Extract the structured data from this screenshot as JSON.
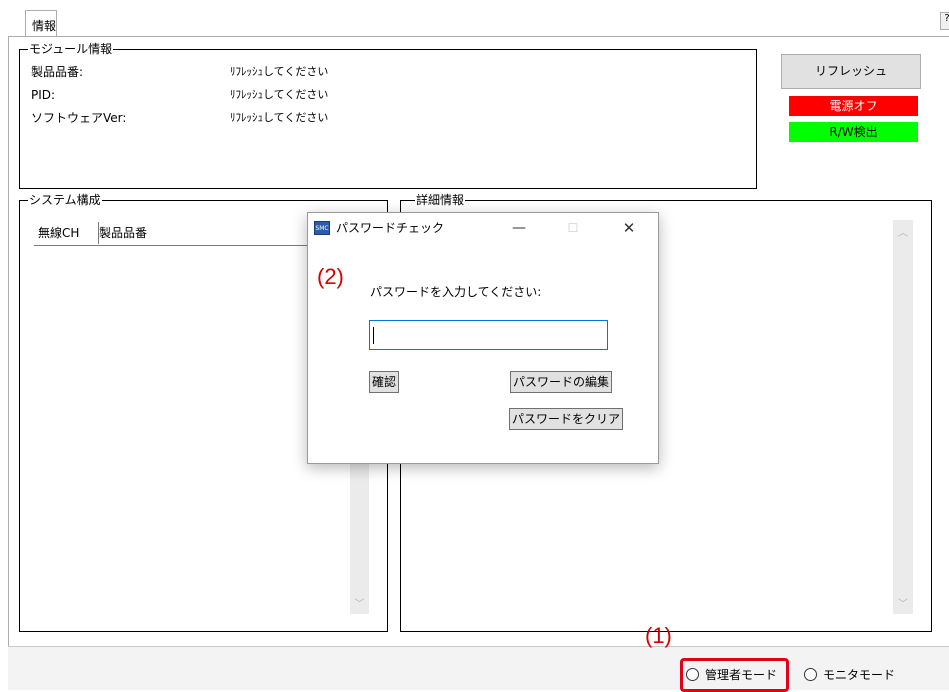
{
  "tabs": [
    {
      "label": "情報"
    }
  ],
  "help_glyph": "?",
  "module_info": {
    "title": "モジュール情報",
    "rows": [
      {
        "label": "製品品番:",
        "value": "ﾘﾌﾚｯｼｭしてください"
      },
      {
        "label": "PID:",
        "value": "ﾘﾌﾚｯｼｭしてください"
      },
      {
        "label": "ソフトウェアVer:",
        "value": "ﾘﾌﾚｯｼｭしてください"
      }
    ]
  },
  "actions": {
    "refresh_label": "リフレッシュ",
    "status_power": "電源オフ",
    "status_rw": "R/W検出"
  },
  "system_config": {
    "title": "システム構成",
    "columns": [
      "無線CH",
      "製品品番"
    ]
  },
  "details": {
    "title": "詳細情報"
  },
  "dialog": {
    "title": "パスワードチェック",
    "icon_text": "SMC",
    "minimize_glyph": "—",
    "maximize_glyph": "☐",
    "close_glyph": "✕",
    "message": "パスワードを入力してください:",
    "input_value": "",
    "confirm_label": "確認",
    "edit_label": "パスワードの編集",
    "clear_label": "パスワードをクリア"
  },
  "mode": {
    "options": [
      {
        "label": "管理者モード",
        "selected": false
      },
      {
        "label": "モニタモード",
        "selected": false
      }
    ]
  },
  "annotations": {
    "step1": "(1)",
    "step2": "(2)"
  },
  "colors": {
    "power_off": "#ff0000",
    "rw_detect": "#00ff00",
    "annotation": "#d40000"
  }
}
